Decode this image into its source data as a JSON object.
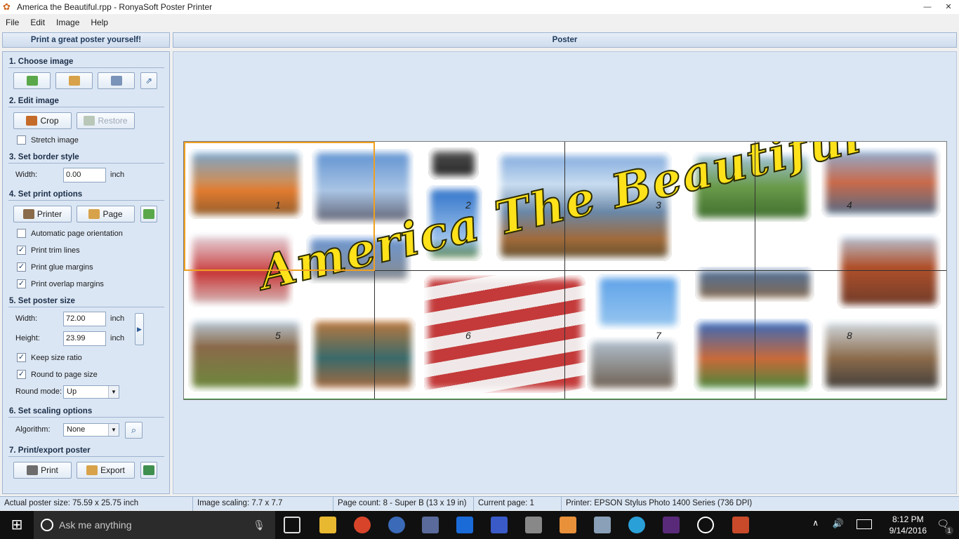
{
  "window": {
    "title": "America  the Beautiful.rpp - RonyaSoft Poster Printer"
  },
  "menu": [
    "File",
    "Edit",
    "Image",
    "Help"
  ],
  "left_panel": {
    "header": "Print a great poster yourself!",
    "choose_image": {
      "title": "1. Choose image"
    },
    "edit_image": {
      "title": "2. Edit image",
      "crop": "Crop",
      "restore": "Restore",
      "stretch": "Stretch image"
    },
    "border_style": {
      "title": "3. Set border style",
      "width_label": "Width:",
      "width_value": "0.00",
      "unit": "inch"
    },
    "print_options": {
      "title": "4. Set print options",
      "printer": "Printer",
      "page": "Page",
      "auto_orient": "Automatic page orientation",
      "trim": "Print trim lines",
      "glue": "Print glue margins",
      "overlap": "Print overlap margins"
    },
    "poster_size": {
      "title": "5. Set poster size",
      "width_label": "Width:",
      "width_value": "72.00",
      "height_label": "Height:",
      "height_value": "23.99",
      "unit": "inch",
      "keep_ratio": "Keep size ratio",
      "round_page": "Round to page size",
      "round_mode_label": "Round mode:",
      "round_mode_value": "Up"
    },
    "scaling": {
      "title": "6. Set scaling options",
      "algorithm_label": "Algorithm:",
      "algorithm_value": "None"
    },
    "export": {
      "title": "7. Print/export poster",
      "print": "Print",
      "export": "Export"
    }
  },
  "poster": {
    "header": "Poster",
    "headline": "America The Beautiful",
    "pages": [
      "1",
      "2",
      "3",
      "4",
      "5",
      "6",
      "7",
      "8"
    ]
  },
  "status": {
    "actual_size": "Actual poster size: 75.59 x 25.75 inch",
    "scaling": "Image scaling: 7.7 x 7.7",
    "page_count": "Page count: 8 - Super B (13 x 19 in)",
    "current_page": "Current page: 1",
    "printer": "Printer: EPSON Stylus Photo 1400 Series (736 DPI)"
  },
  "taskbar": {
    "search_placeholder": "Ask me anything",
    "time": "8:12 PM",
    "date": "9/14/2016",
    "notification_count": "1"
  }
}
